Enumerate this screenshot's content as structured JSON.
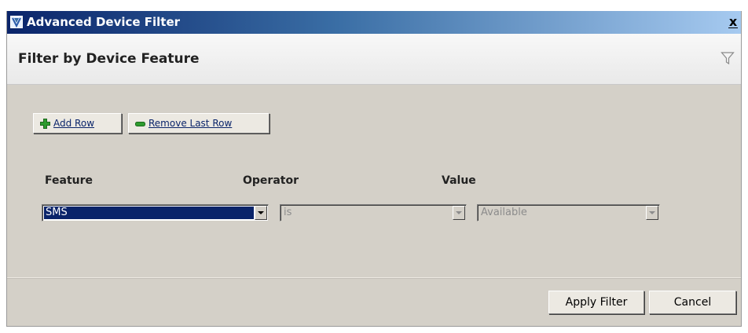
{
  "window": {
    "title": "Advanced Device Filter",
    "close_label": "x"
  },
  "header": {
    "title": "Filter by Device Feature",
    "icon": "funnel-icon"
  },
  "toolbar": {
    "add_row_label": "Add Row",
    "add_row_icon": "plus-icon",
    "remove_row_label": "Remove Last Row",
    "remove_row_icon": "minus-icon"
  },
  "columns": {
    "feature": "Feature",
    "operator": "Operator",
    "value": "Value"
  },
  "rows": [
    {
      "feature": "SMS",
      "operator": "is",
      "value": "Available",
      "operator_enabled": false,
      "value_enabled": false
    }
  ],
  "footer": {
    "apply_label": "Apply Filter",
    "cancel_label": "Cancel"
  },
  "colors": {
    "titlebar_start": "#0a246a",
    "titlebar_end": "#a6caf0",
    "dialog_bg": "#d4d0c8",
    "selection_bg": "#0a246a",
    "link_text": "#0a246a",
    "plus_icon": "#2e9b2e",
    "minus_icon": "#2e9b2e"
  }
}
